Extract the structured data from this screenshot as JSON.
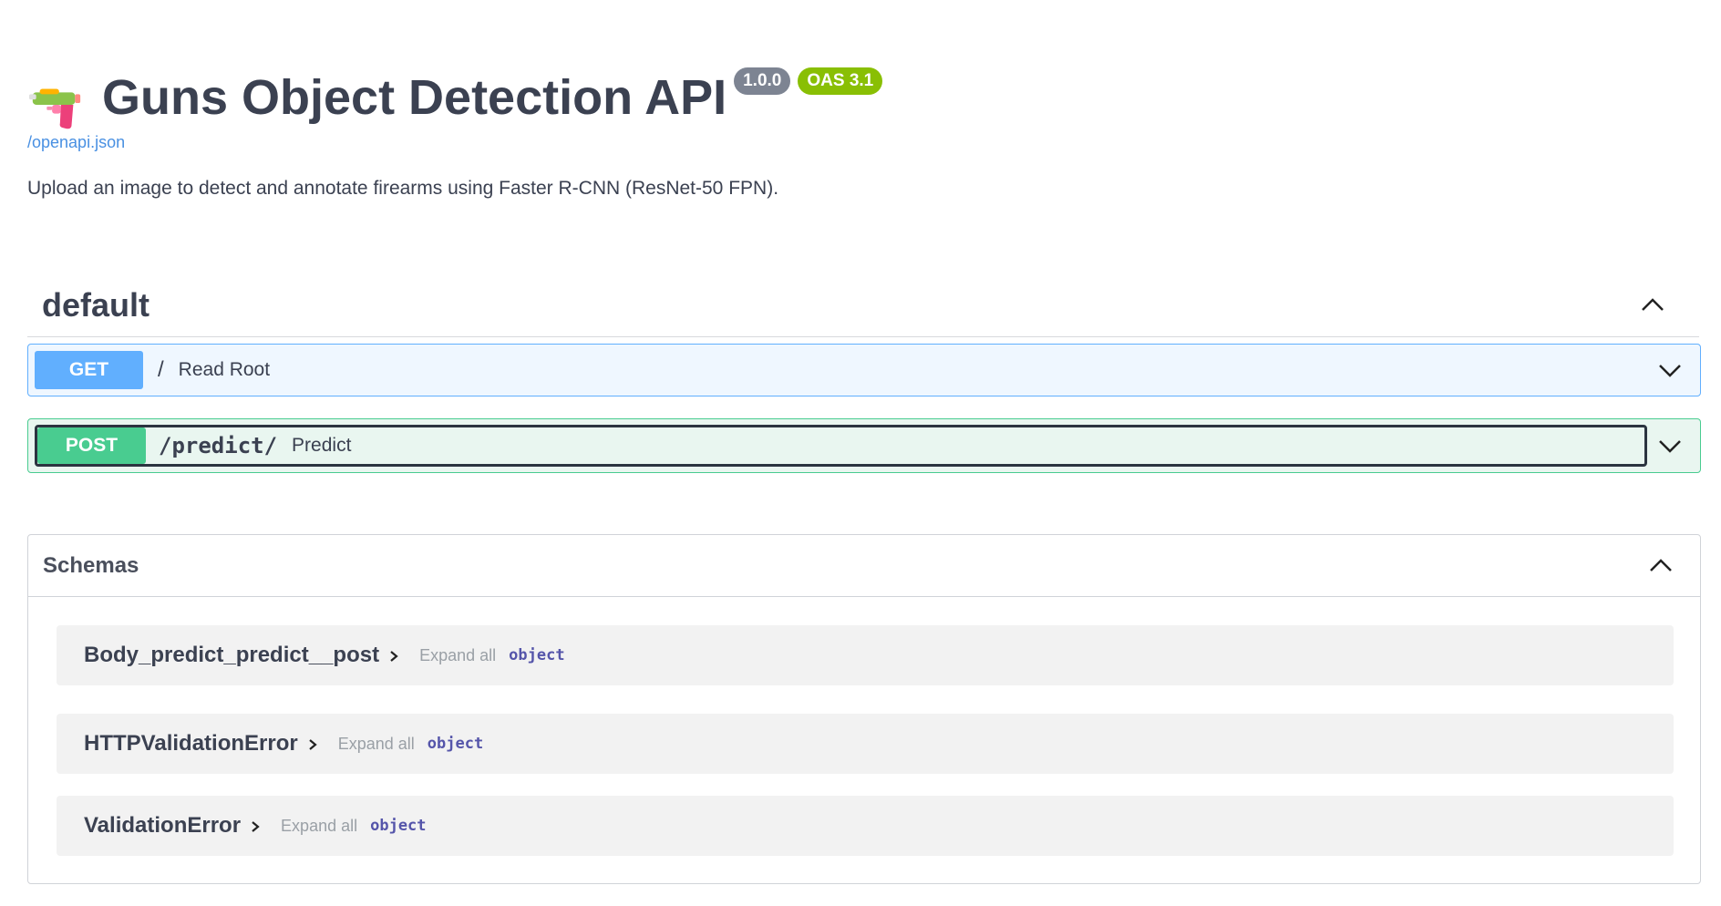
{
  "info": {
    "title": "Guns Object Detection API",
    "version": "1.0.0",
    "oas_version": "OAS 3.1",
    "spec_link": "/openapi.json",
    "description": "Upload an image to detect and annotate firearms using Faster R-CNN (ResNet-50 FPN)."
  },
  "tag": {
    "name": "default"
  },
  "operations": [
    {
      "method": "GET",
      "path": "/",
      "summary": "Read Root"
    },
    {
      "method": "POST",
      "path": "/predict/",
      "summary": "Predict"
    }
  ],
  "schemas": {
    "title": "Schemas",
    "models": [
      {
        "name": "Body_predict_predict__post",
        "expand_label": "Expand all",
        "type": "object"
      },
      {
        "name": "HTTPValidationError",
        "expand_label": "Expand all",
        "type": "object"
      },
      {
        "name": "ValidationError",
        "expand_label": "Expand all",
        "type": "object"
      }
    ]
  },
  "colors": {
    "get": "#61affe",
    "post": "#49cc90",
    "version_badge": "#7d8492",
    "oas_badge": "#89bf04",
    "link": "#4990e2"
  }
}
